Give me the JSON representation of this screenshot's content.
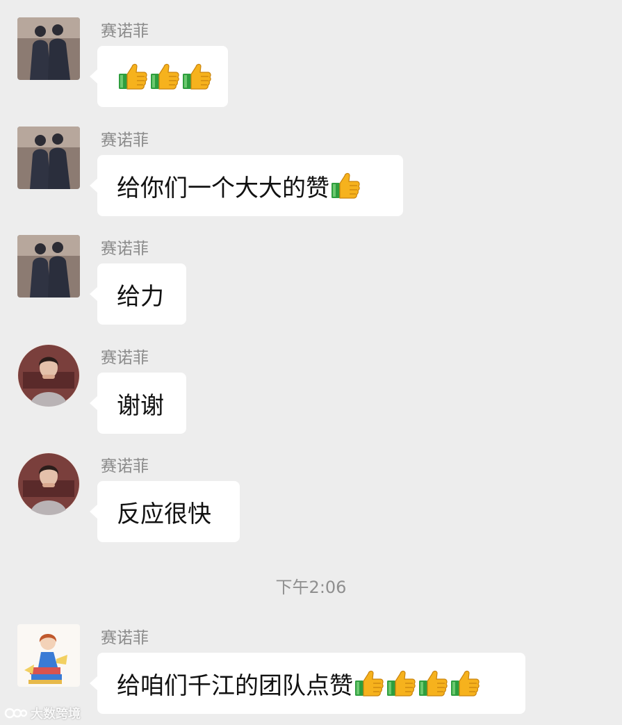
{
  "chat": {
    "messages": [
      {
        "sender": "赛诺菲",
        "avatar_icon": "silhouette-couple-avatar-icon",
        "text": "",
        "thumbs_up_count": 3
      },
      {
        "sender": "赛诺菲",
        "avatar_icon": "silhouette-couple-avatar-icon",
        "text": "给你们一个大大的赞",
        "thumbs_up_count": 1
      },
      {
        "sender": "赛诺菲",
        "avatar_icon": "silhouette-couple-avatar-icon",
        "text": "给力",
        "thumbs_up_count": 0
      },
      {
        "sender": "赛诺菲",
        "avatar_icon": "woman-portrait-avatar-icon",
        "text": "谢谢",
        "thumbs_up_count": 0
      },
      {
        "sender": "赛诺菲",
        "avatar_icon": "woman-portrait-avatar-icon",
        "text": "反应很快",
        "thumbs_up_count": 0
      },
      {
        "sender": "赛诺菲",
        "avatar_icon": "cartoon-girl-reading-avatar-icon",
        "text": "给咱们千江的团队点赞",
        "thumbs_up_count": 4
      }
    ],
    "timestamp": "下午2:06"
  },
  "watermark": {
    "text": "大数跨境",
    "icon": "brand-logo-icon"
  },
  "colors": {
    "background": "#ededed",
    "bubble": "#ffffff",
    "sender_text": "#8a8a8a",
    "time_text": "#8f8f8f",
    "thumb_yellow": "#f6b21d",
    "thumb_cuff": "#2e9e3e"
  }
}
